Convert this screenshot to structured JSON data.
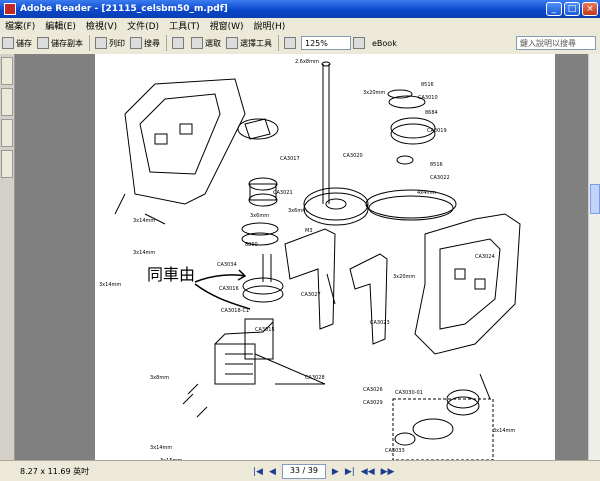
{
  "window": {
    "title": "Adobe Reader - [21115_celsbm50_m.pdf]"
  },
  "menu": [
    "檔案(F)",
    "編輯(E)",
    "檢視(V)",
    "文件(D)",
    "工具(T)",
    "視窗(W)",
    "說明(H)"
  ],
  "toolbar": {
    "save_label": "儲存",
    "save_copy_label": "儲存副本",
    "print_label": "列印",
    "search_label": "搜尋",
    "select_label": "選取",
    "snapshot_label": "選擇工具",
    "zoom_value": "125%",
    "adobe_label": "eBook",
    "help_placeholder": "鍵入說明以搜尋"
  },
  "status": {
    "page_size": "8.27 x 11.69 英吋",
    "page_indicator": "33 / 39"
  },
  "diagram": {
    "handwritten_note": "同車由",
    "labels": {
      "screw_top": "2.6x8mm",
      "cb_3020": "CA3020",
      "m3x20_top": "3x20mm",
      "cb_8516_a": "8516",
      "cb_3010": "CA3010",
      "cb_8684": "8684",
      "cb_3019": "CA3019",
      "cb_8516_b": "8516",
      "cb_3022": "CA3022",
      "m4x4": "4x4mm",
      "cb_3017": "CA3017",
      "cb_3021": "CA3021",
      "m3x6": "3x6mm",
      "m3x6b": "3x6mm",
      "m3": "M3",
      "m3x14a": "3x14mm",
      "m3x14b": "3x14mm",
      "m3x14c": "3x14mm",
      "cb_8860": "8860",
      "cb_3034": "CA3034",
      "cb_3016": "CA3016",
      "cb_3018c1": "CA3018-C1",
      "m3x20_mid": "3x20mm",
      "cb_3024": "CA3024",
      "cb_3027": "CA3027",
      "cb_3015": "CA3015",
      "cb_3023": "CA3023",
      "cb_3028": "CA3028",
      "cb_3026": "CA3026",
      "cb_3029": "CA3029",
      "m3x8": "3x8mm",
      "m3x14d": "3x14mm",
      "m3x15": "3x15mm",
      "m3x14e": "3x14mm",
      "cb_30301": "CA3030-01",
      "m3x10": "3x10mm",
      "cb_3033": "CA3033"
    }
  }
}
